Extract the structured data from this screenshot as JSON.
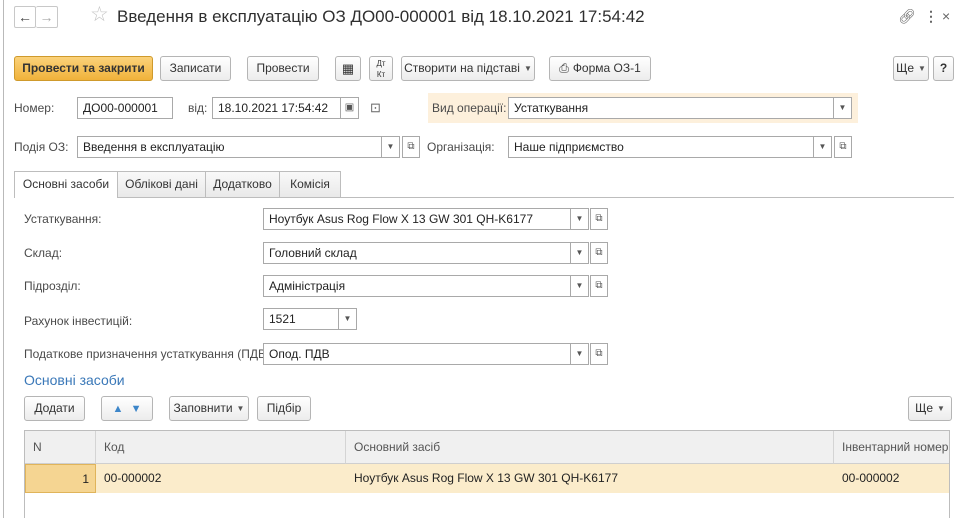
{
  "window": {
    "title": "Введення в експлуатацію ОЗ ДО00-000001 від 18.10.2021 17:54:42",
    "icons": [
      "back-arrow",
      "forward-arrow",
      "star",
      "link",
      "kebab-menu",
      "close"
    ]
  },
  "toolbar": {
    "post_and_close": "Провести та закрити",
    "save": "Записати",
    "post": "Провести",
    "create_based_on": "Створити на підставі",
    "form_os1": "Форма ОЗ-1",
    "more": "Ще",
    "help": "?"
  },
  "header": {
    "number_label": "Номер:",
    "number_value": "ДО00-000001",
    "date_label": "від:",
    "date_value": "18.10.2021 17:54:42",
    "operation_label": "Вид операції:",
    "operation_value": "Устаткування",
    "event_label": "Подія ОЗ:",
    "event_value": "Введення в експлуатацію",
    "org_label": "Організація:",
    "org_value": "Наше підприємство"
  },
  "tabs": [
    "Основні засоби",
    "Облікові дані",
    "Додатково",
    "Комісія"
  ],
  "form": {
    "equipment_label": "Устаткування:",
    "equipment_value": "Ноутбук Asus Rog Flow X 13 GW 301 QH-K6177",
    "warehouse_label": "Склад:",
    "warehouse_value": "Головний склад",
    "department_label": "Підрозділ:",
    "department_value": "Адміністрація",
    "account_label": "Рахунок інвестицій:",
    "account_value": "1521",
    "vat_label": "Податкове призначення устаткування (ПДВ):",
    "vat_value": "Опод. ПДВ"
  },
  "assets": {
    "section_title": "Основні засоби",
    "add": "Додати",
    "fill": "Заповнити",
    "pick": "Підбір",
    "more": "Ще",
    "columns": [
      "N",
      "Код",
      "Основний засіб",
      "Інвентарний номер"
    ],
    "rows": [
      {
        "n": "1",
        "code": "00-000002",
        "asset": "Ноутбук Asus Rog Flow X 13 GW 301 QH-K6177",
        "inventory": "00-000002"
      }
    ]
  },
  "colors": {
    "primary_button": "#f0b23a",
    "link_blue": "#3a78b8",
    "selected_row": "#fbeccb",
    "operation_highlight": "#fdf0dc"
  }
}
